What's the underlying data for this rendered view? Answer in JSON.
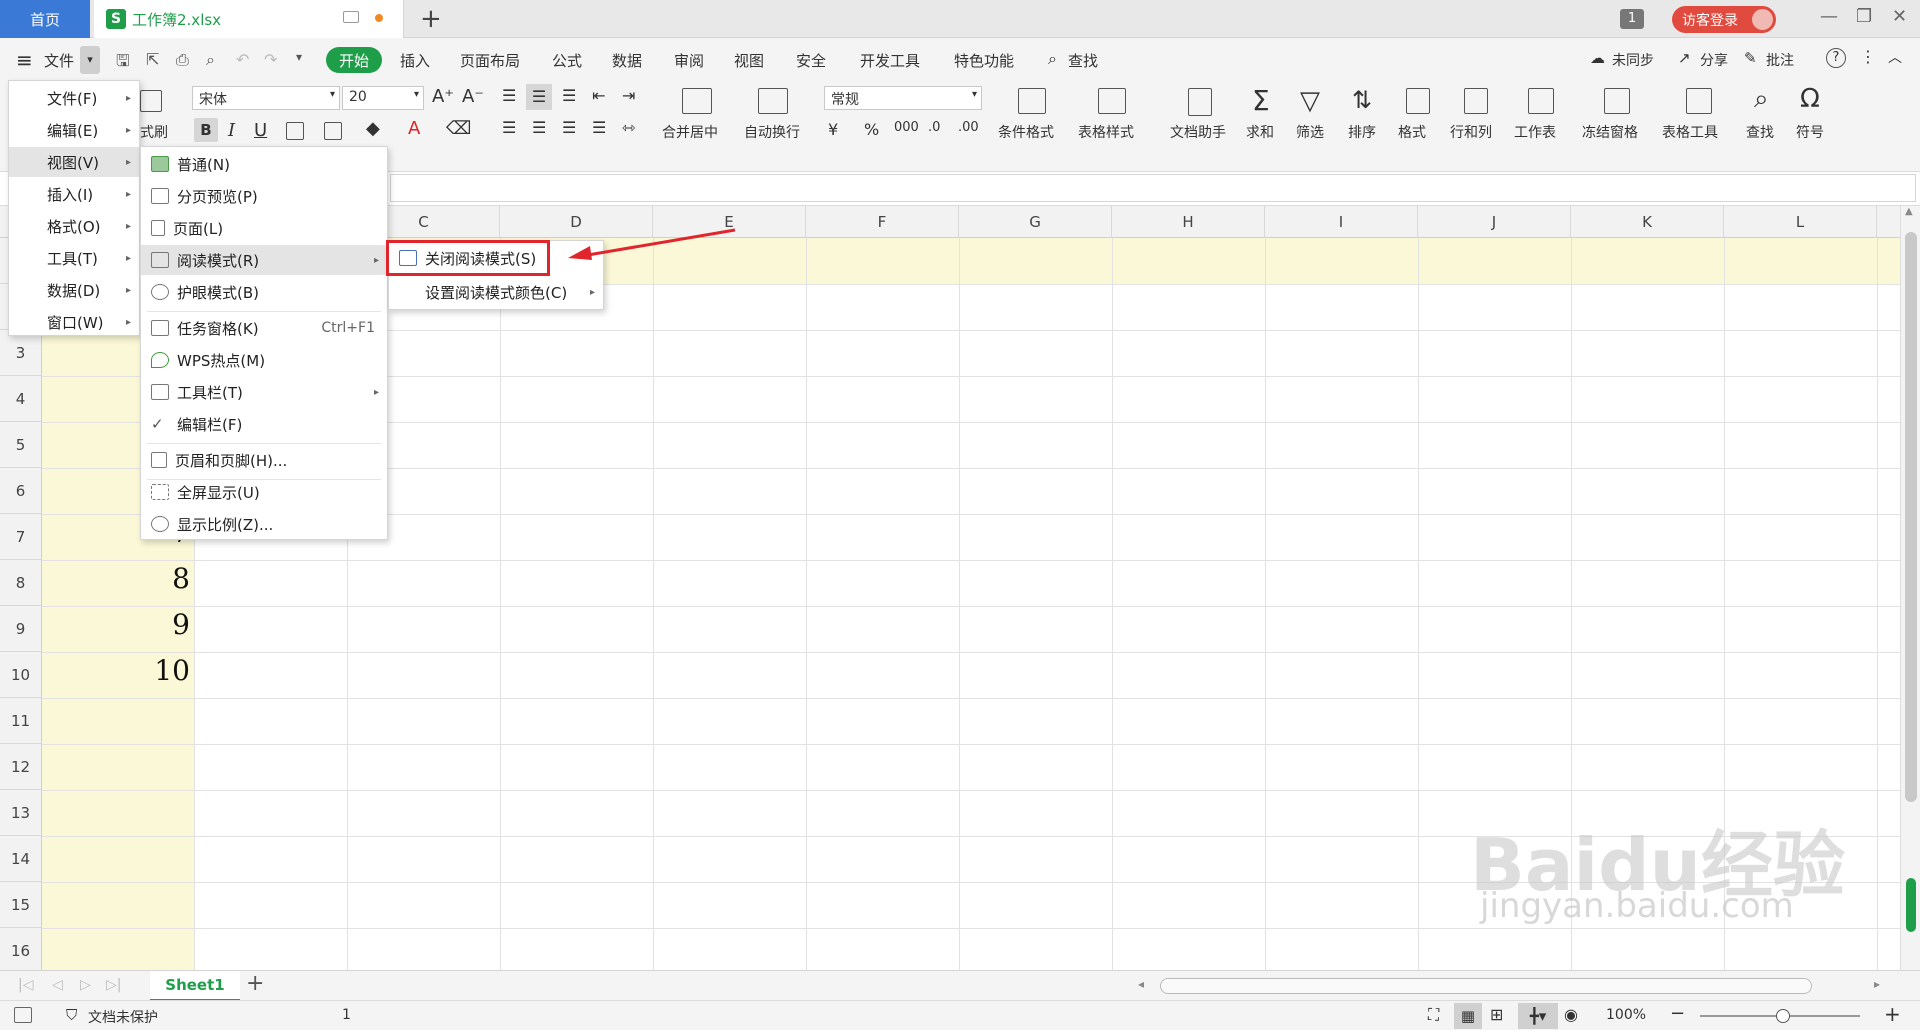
{
  "titlebar": {
    "home_tab": "首页",
    "doc_tab": "工作簿2.xlsx",
    "new_tab": "+",
    "window_badge": "1",
    "guest_login": "访客登录"
  },
  "menubar": {
    "file": "文件",
    "tabs": [
      "开始",
      "插入",
      "页面布局",
      "公式",
      "数据",
      "审阅",
      "视图",
      "安全",
      "开发工具",
      "特色功能"
    ],
    "search": "查找",
    "right": {
      "sync": "未同步",
      "share": "分享",
      "comment": "批注"
    }
  },
  "ribbon": {
    "format_painter": "式刷",
    "font_name": "宋体",
    "font_size": "20",
    "number_format": "常规",
    "merge_center": "合并居中",
    "wrap_text": "自动换行",
    "conditional_format": "条件格式",
    "table_style": "表格样式",
    "doc_helper": "文档助手",
    "sum": "求和",
    "filter": "筛选",
    "sort": "排序",
    "format": "格式",
    "rows_cols": "行和列",
    "worksheet": "工作表",
    "freeze": "冻结窗格",
    "table_tools": "表格工具",
    "find": "查找",
    "symbol": "符号"
  },
  "columns": [
    "C",
    "D",
    "E",
    "F",
    "G",
    "H",
    "I",
    "J",
    "K",
    "L"
  ],
  "rows": [
    "3",
    "4",
    "5",
    "6",
    "7",
    "8",
    "9",
    "10",
    "11",
    "12",
    "13",
    "14",
    "15",
    "16"
  ],
  "cells": {
    "row7": "7",
    "row8": "8",
    "row9": "9",
    "row10": "10"
  },
  "file_menu": [
    "文件(F)",
    "编辑(E)",
    "视图(V)",
    "插入(I)",
    "格式(O)",
    "工具(T)",
    "数据(D)",
    "窗口(W)"
  ],
  "view_menu": {
    "items": [
      "普通(N)",
      "分页预览(P)",
      "页面(L)",
      "阅读模式(R)",
      "护眼模式(B)",
      "任务窗格(K)",
      "WPS热点(M)",
      "工具栏(T)",
      "编辑栏(F)",
      "页眉和页脚(H)...",
      "全屏显示(U)",
      "显示比例(Z)..."
    ],
    "task_pane_shortcut": "Ctrl+F1"
  },
  "reading_submenu": [
    "关闭阅读模式(S)",
    "设置阅读模式颜色(C)"
  ],
  "sheetbar": {
    "sheet_name": "Sheet1",
    "add": "+"
  },
  "statusbar": {
    "protect": "文档未保护",
    "count": "1",
    "zoom": "100%"
  },
  "watermark": {
    "brand": "Baidu经验",
    "url": "jingyan.baidu.com"
  },
  "colors": {
    "accent": "#1f9e4a",
    "home_tab": "#3a7ad6",
    "guest": "#e14a3e",
    "highlight": "#fbf8d7",
    "annotation": "#e0262c"
  }
}
